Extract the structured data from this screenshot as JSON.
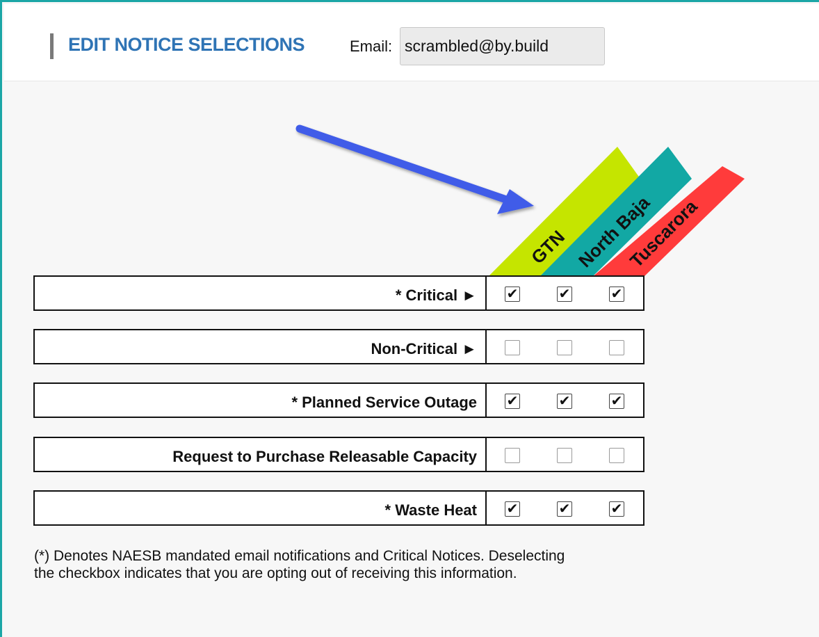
{
  "header": {
    "title": "EDIT NOTICE SELECTIONS",
    "email_label": "Email:",
    "email_value": "scrambled@by.build"
  },
  "columns": [
    {
      "label": "GTN",
      "color": "#c5e500"
    },
    {
      "label": "North Baja",
      "color": "#12a8a4"
    },
    {
      "label": "Tuscarora",
      "color": "#ff3b3b"
    }
  ],
  "rows": [
    {
      "label": "* Critical ►",
      "checked": [
        true,
        true,
        true
      ]
    },
    {
      "label": "Non-Critical ►",
      "checked": [
        false,
        false,
        false
      ]
    },
    {
      "label": "* Planned Service Outage",
      "checked": [
        true,
        true,
        true
      ]
    },
    {
      "label": "Request to Purchase Releasable Capacity",
      "checked": [
        false,
        false,
        false
      ]
    },
    {
      "label": "* Waste Heat",
      "checked": [
        true,
        true,
        true
      ]
    }
  ],
  "footnote": {
    "line1": "(*) Denotes NAESB mandated email notifications and Critical Notices. Deselecting",
    "line2": "the checkbox indicates that you are opting out of receiving this information."
  },
  "accent_color": "#1ba6a6",
  "arrow_color": "#3f5be8"
}
